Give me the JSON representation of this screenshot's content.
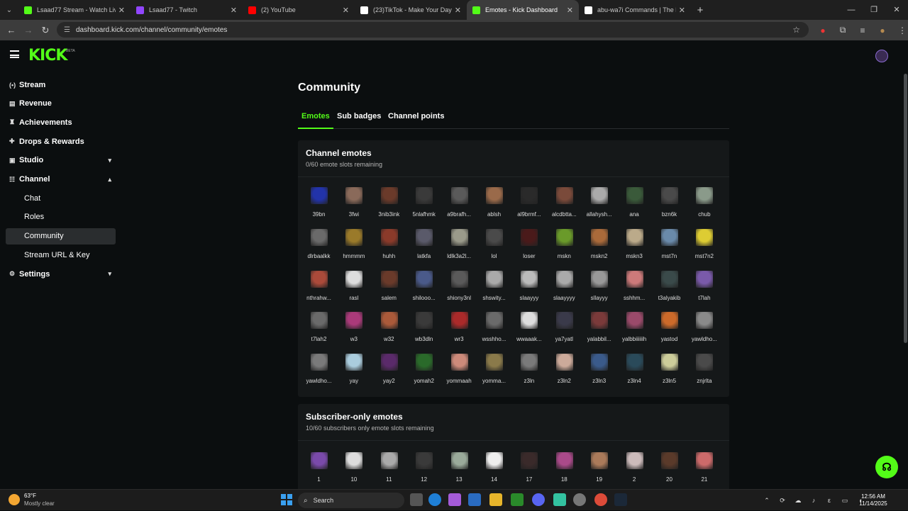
{
  "browser": {
    "tabs": [
      {
        "title": "Lsaad77 Stream - Watch Live o",
        "icon": "kick-icon",
        "color": "#53fc18",
        "active": false
      },
      {
        "title": "Lsaad77 - Twitch",
        "icon": "twitch-icon",
        "color": "#9146ff",
        "active": false
      },
      {
        "title": "(2) YouTube",
        "icon": "youtube-icon",
        "color": "#ff0000",
        "active": false
      },
      {
        "title": "(23)TikTok - Make Your Day",
        "icon": "tiktok-icon",
        "color": "#ffffff",
        "active": false
      },
      {
        "title": "Emotes - Kick Dashboard",
        "icon": "kick-icon",
        "color": "#53fc18",
        "active": true
      },
      {
        "title": "abu-wa7i Commands | The bes",
        "icon": "diamond-icon",
        "color": "#ffffff",
        "active": false
      }
    ],
    "url": "dashboard.kick.com/channel/community/emotes"
  },
  "header": {
    "logo": "KICK",
    "beta": "BETA"
  },
  "sidebar": {
    "items": [
      {
        "label": "Stream",
        "icon": "broadcast-icon",
        "glyph": "(•)"
      },
      {
        "label": "Revenue",
        "icon": "revenue-icon",
        "glyph": "▤"
      },
      {
        "label": "Achievements",
        "icon": "trophy-icon",
        "glyph": "♜"
      },
      {
        "label": "Drops & Rewards",
        "icon": "gift-icon",
        "glyph": "✚"
      },
      {
        "label": "Studio",
        "icon": "studio-icon",
        "glyph": "▣",
        "chevron": "▾"
      },
      {
        "label": "Channel",
        "icon": "channel-icon",
        "glyph": "☷",
        "chevron": "▴"
      }
    ],
    "channel_sub": [
      {
        "label": "Chat"
      },
      {
        "label": "Roles"
      },
      {
        "label": "Community",
        "active": true
      },
      {
        "label": "Stream URL & Key"
      }
    ],
    "settings": {
      "label": "Settings",
      "glyph": "⚙",
      "chevron": "▾"
    }
  },
  "main": {
    "title": "Community",
    "tabs": [
      "Emotes",
      "Sub badges",
      "Channel points"
    ],
    "channel_emotes": {
      "title": "Channel emotes",
      "subtitle": "0/60 emote slots remaining",
      "emotes": [
        {
          "name": "39bn",
          "color": "#2233aa"
        },
        {
          "name": "3fwi",
          "color": "#8a6a5a"
        },
        {
          "name": "3nib3ink",
          "color": "#6a3a2a"
        },
        {
          "name": "5nlafhmk",
          "color": "#3a3a3a"
        },
        {
          "name": "a9brafh...",
          "color": "#5a5a5a"
        },
        {
          "name": "ablsh",
          "color": "#9a6a4a"
        },
        {
          "name": "al9brmf...",
          "color": "#2a2a2a"
        },
        {
          "name": "alcdbtta...",
          "color": "#7a4a3a"
        },
        {
          "name": "allahysh...",
          "color": "#aaaaaa"
        },
        {
          "name": "ana",
          "color": "#3a5a3a"
        },
        {
          "name": "bzn6k",
          "color": "#4a4a4a"
        },
        {
          "name": "chub",
          "color": "#8a9a8a"
        },
        {
          "name": "dlrbaalkk",
          "color": "#6a6a6a"
        },
        {
          "name": "hmmmm",
          "color": "#9a7a2a"
        },
        {
          "name": "huhh",
          "color": "#8a3a2a"
        },
        {
          "name": "latkfa",
          "color": "#5a5a6a"
        },
        {
          "name": "ldlk3a2l...",
          "color": "#9a9a8a"
        },
        {
          "name": "lol",
          "color": "#4a4a4a"
        },
        {
          "name": "loser",
          "color": "#4a1a1a"
        },
        {
          "name": "mskn",
          "color": "#6a9a2a"
        },
        {
          "name": "mskn2",
          "color": "#aa6a3a"
        },
        {
          "name": "mskn3",
          "color": "#bbaa8a"
        },
        {
          "name": "mst7n",
          "color": "#6a8aaa"
        },
        {
          "name": "mst7n2",
          "color": "#ddcc33"
        },
        {
          "name": "nthrahw...",
          "color": "#aa4a3a"
        },
        {
          "name": "rasl",
          "color": "#dddddd"
        },
        {
          "name": "salem",
          "color": "#6a3a2a"
        },
        {
          "name": "shilooo...",
          "color": "#4a5a8a"
        },
        {
          "name": "shiony3nl",
          "color": "#5a5a5a"
        },
        {
          "name": "shswity...",
          "color": "#aaaaaa"
        },
        {
          "name": "slaayyy",
          "color": "#bbbbbb"
        },
        {
          "name": "slaayyyy",
          "color": "#aaaaaa"
        },
        {
          "name": "sllayyy",
          "color": "#999999"
        },
        {
          "name": "sshhm...",
          "color": "#cc7a7a"
        },
        {
          "name": "t3alyakib",
          "color": "#3a4a4a"
        },
        {
          "name": "t7lah",
          "color": "#7a5aaa"
        },
        {
          "name": "t7lah2",
          "color": "#6a6a6a"
        },
        {
          "name": "w3",
          "color": "#aa3a7a"
        },
        {
          "name": "w32",
          "color": "#aa5a3a"
        },
        {
          "name": "wb3dln",
          "color": "#3a3a3a"
        },
        {
          "name": "wr3",
          "color": "#aa2a2a"
        },
        {
          "name": "wsshho...",
          "color": "#6a6a6a"
        },
        {
          "name": "wwaaak...",
          "color": "#dddddd"
        },
        {
          "name": "ya7yatl",
          "color": "#3a3a4a"
        },
        {
          "name": "yalabbil...",
          "color": "#7a3a3a"
        },
        {
          "name": "yalbbiiiiiih",
          "color": "#9a4a6a"
        },
        {
          "name": "yastod",
          "color": "#cc6a2a"
        },
        {
          "name": "yawldho...",
          "color": "#8a8a8a"
        },
        {
          "name": "yawldho...",
          "color": "#7a7a7a"
        },
        {
          "name": "yay",
          "color": "#aaccdd"
        },
        {
          "name": "yay2",
          "color": "#5a2a6a"
        },
        {
          "name": "yomah2",
          "color": "#2a6a2a"
        },
        {
          "name": "yommaah",
          "color": "#cc8a7a"
        },
        {
          "name": "yomma...",
          "color": "#8a7a4a"
        },
        {
          "name": "z3ln",
          "color": "#7a7a7a"
        },
        {
          "name": "z3ln2",
          "color": "#ccaa9a"
        },
        {
          "name": "z3ln3",
          "color": "#3a5a8a"
        },
        {
          "name": "z3ln4",
          "color": "#2a4a5a"
        },
        {
          "name": "z3ln5",
          "color": "#cccc9a"
        },
        {
          "name": "znjrlta",
          "color": "#4a4a4a"
        }
      ]
    },
    "subscriber_emotes": {
      "title": "Subscriber-only emotes",
      "subtitle": "10/60 subscribers only emote slots remaining",
      "emotes": [
        {
          "name": "1",
          "color": "#7a4aaa"
        },
        {
          "name": "10",
          "color": "#dddddd"
        },
        {
          "name": "11",
          "color": "#aaaaaa"
        },
        {
          "name": "12",
          "color": "#3a3a3a"
        },
        {
          "name": "13",
          "color": "#9aaa9a"
        },
        {
          "name": "14",
          "color": "#eeeeee"
        },
        {
          "name": "17",
          "color": "#3a2a2a"
        },
        {
          "name": "18",
          "color": "#aa4a8a"
        },
        {
          "name": "19",
          "color": "#aa7a5a"
        },
        {
          "name": "2",
          "color": "#ccbbbb"
        },
        {
          "name": "20",
          "color": "#5a3a2a"
        },
        {
          "name": "21",
          "color": "#cc6a6a"
        }
      ]
    }
  },
  "taskbar": {
    "temp": "63°F",
    "condition": "Mostly clear",
    "search": "Search",
    "time": "12:56 AM",
    "date": "11/14/2025"
  }
}
